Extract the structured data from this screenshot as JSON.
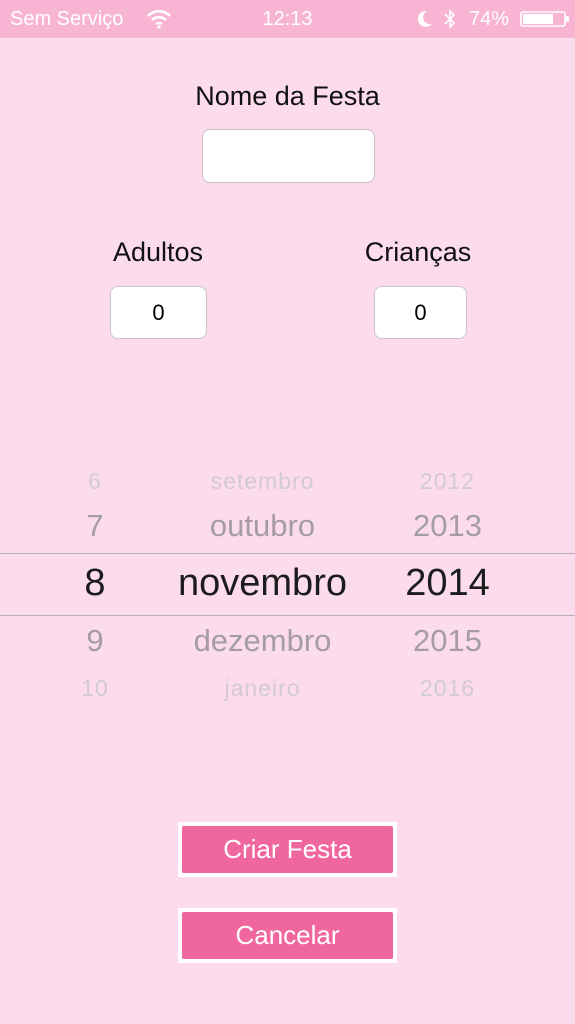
{
  "status_bar": {
    "carrier": "Sem Serviço",
    "time": "12:13",
    "battery": "74%"
  },
  "form": {
    "party_name_label": "Nome da Festa",
    "party_name_value": "",
    "adults_label": "Adultos",
    "adults_value": "0",
    "children_label": "Crianças",
    "children_value": "0"
  },
  "date_picker": {
    "days": [
      "6",
      "7",
      "8",
      "9",
      "10"
    ],
    "months": [
      "setembro",
      "outubro",
      "novembro",
      "dezembro",
      "janeiro"
    ],
    "years": [
      "2012",
      "2013",
      "2014",
      "2015",
      "2016"
    ],
    "selected": {
      "day": "8",
      "month": "novembro",
      "year": "2014"
    }
  },
  "actions": {
    "create_label": "Criar Festa",
    "cancel_label": "Cancelar"
  },
  "colors": {
    "background": "#fcdcec",
    "status_bar": "#f7b5d3",
    "button": "#f0669e"
  }
}
